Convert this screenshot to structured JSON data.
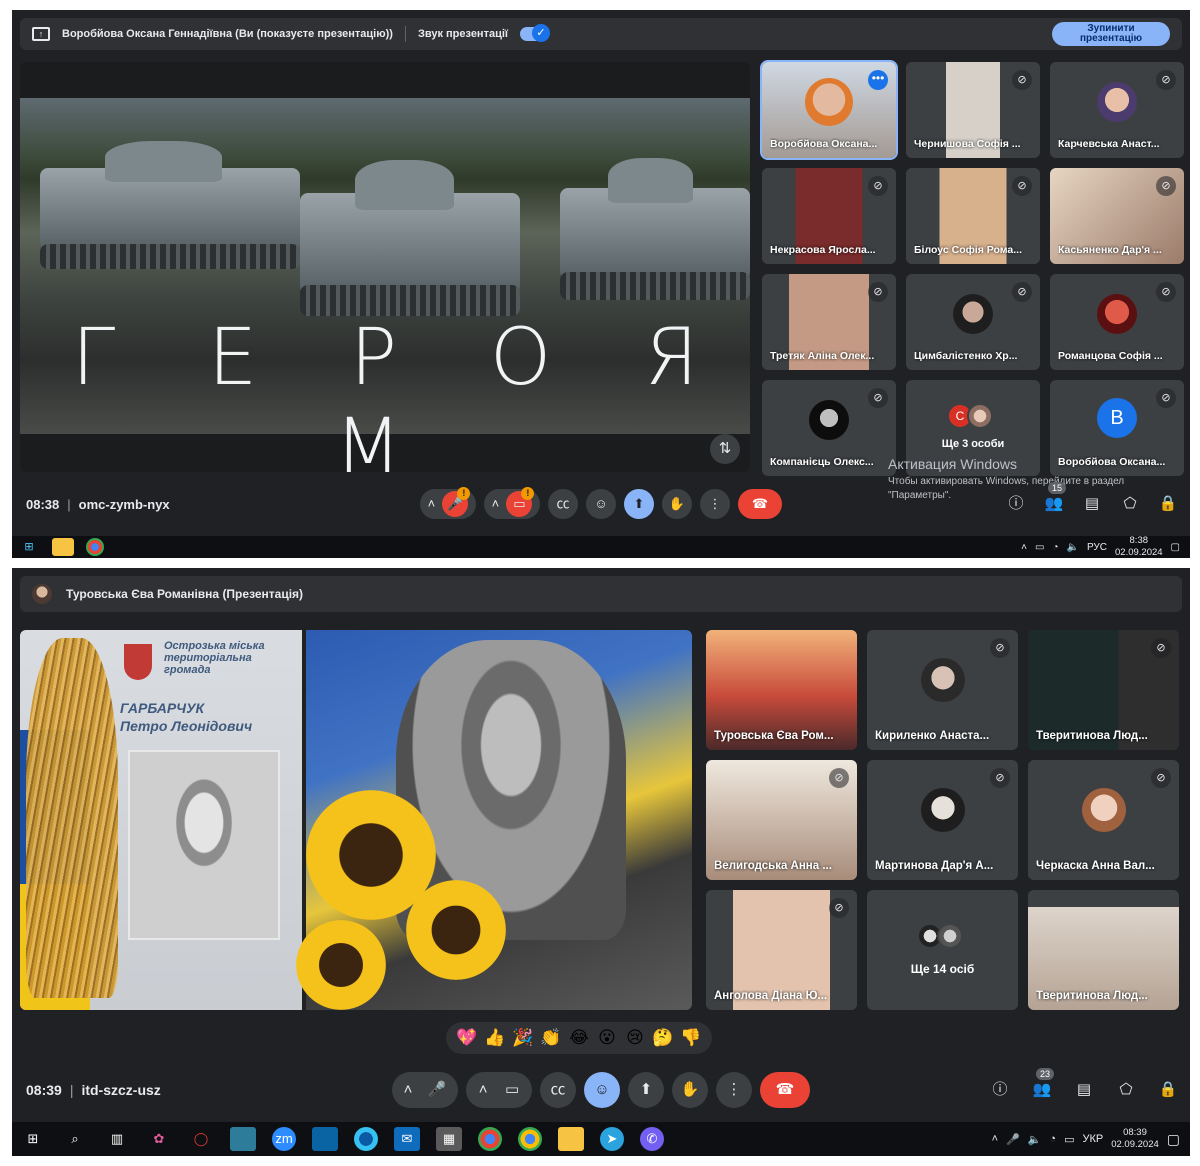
{
  "top": {
    "presenter_bar": {
      "presenter": "Воробйова Оксана Геннадіївна (Ви (показуєте презентацію))",
      "sound_label": "Звук презентації",
      "stop_button": "Зупинити презентацію"
    },
    "slide_title": "Г Е Р О Я М",
    "participants": [
      {
        "name": "Воробйова Оксана...",
        "self": true
      },
      {
        "name": "Чернишова Софія ..."
      },
      {
        "name": "Карчевська Анаст..."
      },
      {
        "name": "Некрасова Яросла..."
      },
      {
        "name": "Білоус Софія Рома..."
      },
      {
        "name": "Касьяненко Дар'я ..."
      },
      {
        "name": "Третяк Аліна Олек..."
      },
      {
        "name": "Цимбалістенко Хр..."
      },
      {
        "name": "Романцова Софія ..."
      },
      {
        "name": "Компанієць Олекс..."
      },
      {
        "name": "Ще 3 особи",
        "avatar_letter": "С"
      },
      {
        "name": "Воробйова Оксана...",
        "avatar_letter": "В"
      }
    ],
    "activation": {
      "title": "Активация Windows",
      "text": "Чтобы активировать Windows, перейдите в раздел \"Параметры\"."
    },
    "time": "08:38",
    "meeting_code": "omc-zymb-nyx",
    "people_count": "15",
    "taskbar": {
      "lang": "РУС",
      "time": "8:38",
      "date": "02.09.2024"
    }
  },
  "bottom": {
    "presenter_bar": {
      "presenter": "Туровська Єва Романівна (Презентація)"
    },
    "memorial": {
      "org": "Острозька міська територіальна громада",
      "name_line1": "ГАРБАРЧУК",
      "name_line2": "Петро Леонідович"
    },
    "participants": [
      {
        "name": "Туровська Єва Ром..."
      },
      {
        "name": "Кириленко Анаста..."
      },
      {
        "name": "Тверитинова Люд..."
      },
      {
        "name": "Велигодська Анна ..."
      },
      {
        "name": "Мартинова Дар'я А..."
      },
      {
        "name": "Черкаска Анна Вал..."
      },
      {
        "name": "Анголова Діана Ю..."
      },
      {
        "name": "Ще 14 осіб"
      },
      {
        "name": "Тверитинова Люд..."
      }
    ],
    "reactions": [
      "💖",
      "👍",
      "🎉",
      "👏",
      "😂",
      "😮",
      "😢",
      "🤔",
      "👎"
    ],
    "time": "08:39",
    "meeting_code": "itd-szcz-usz",
    "people_count": "23",
    "taskbar": {
      "lang": "УКР",
      "time": "08:39",
      "date": "02.09.2024"
    }
  },
  "colors": {
    "meet_bg": "#202124",
    "accent": "#8ab4f8",
    "end_call": "#ea4335",
    "tile_bg": "#3c4043"
  }
}
